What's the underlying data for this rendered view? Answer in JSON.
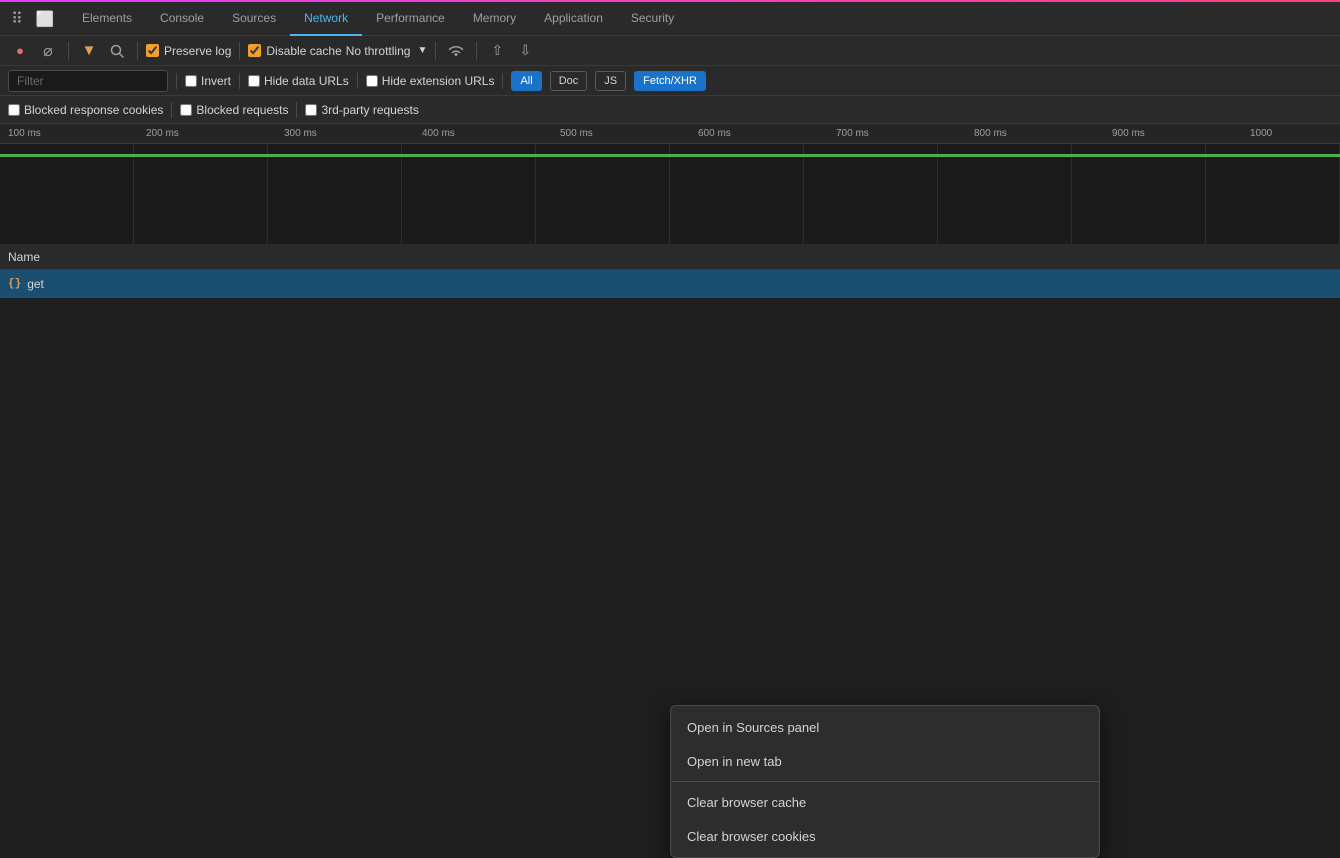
{
  "top_border": true,
  "tabs": {
    "items": [
      {
        "id": "elements",
        "label": "Elements",
        "active": false
      },
      {
        "id": "console",
        "label": "Console",
        "active": false
      },
      {
        "id": "sources",
        "label": "Sources",
        "active": false
      },
      {
        "id": "network",
        "label": "Network",
        "active": true
      },
      {
        "id": "performance",
        "label": "Performance",
        "active": false
      },
      {
        "id": "memory",
        "label": "Memory",
        "active": false
      },
      {
        "id": "application",
        "label": "Application",
        "active": false
      },
      {
        "id": "security",
        "label": "Security",
        "active": false
      }
    ]
  },
  "toolbar": {
    "stop_label": "⏺",
    "clear_label": "⊘",
    "filter_label": "▼",
    "search_label": "🔍",
    "preserve_log": "Preserve log",
    "disable_cache": "Disable cache",
    "throttle_label": "No throttling",
    "wifi_icon": "📶",
    "upload_icon": "⬆",
    "download_icon": "⬇"
  },
  "filter": {
    "placeholder": "Filter",
    "invert_label": "Invert",
    "hide_data_urls_label": "Hide data URLs",
    "hide_extension_urls_label": "Hide extension URLs",
    "type_buttons": [
      {
        "id": "all",
        "label": "All",
        "active": true
      },
      {
        "id": "doc",
        "label": "Doc",
        "active": false
      },
      {
        "id": "js",
        "label": "JS",
        "active": false
      },
      {
        "id": "fetch_xhr",
        "label": "Fetch/XHR",
        "active": true
      }
    ]
  },
  "filter_row2": {
    "blocked_response_cookies": "Blocked response cookies",
    "blocked_requests": "Blocked requests",
    "third_party_requests": "3rd-party requests"
  },
  "timeline": {
    "ticks": [
      "100 ms",
      "200 ms",
      "300 ms",
      "400 ms",
      "500 ms",
      "600 ms",
      "700 ms",
      "800 ms",
      "900 ms",
      "1000"
    ]
  },
  "table": {
    "header": "Name",
    "rows": [
      {
        "icon": "{}",
        "name": "get"
      }
    ]
  },
  "context_menu": {
    "items": [
      {
        "id": "open-sources",
        "label": "Open in Sources panel"
      },
      {
        "id": "open-new-tab",
        "label": "Open in new tab"
      },
      {
        "id": "clear-cache",
        "label": "Clear browser cache"
      },
      {
        "id": "clear-cookies",
        "label": "Clear browser cookies"
      }
    ]
  }
}
